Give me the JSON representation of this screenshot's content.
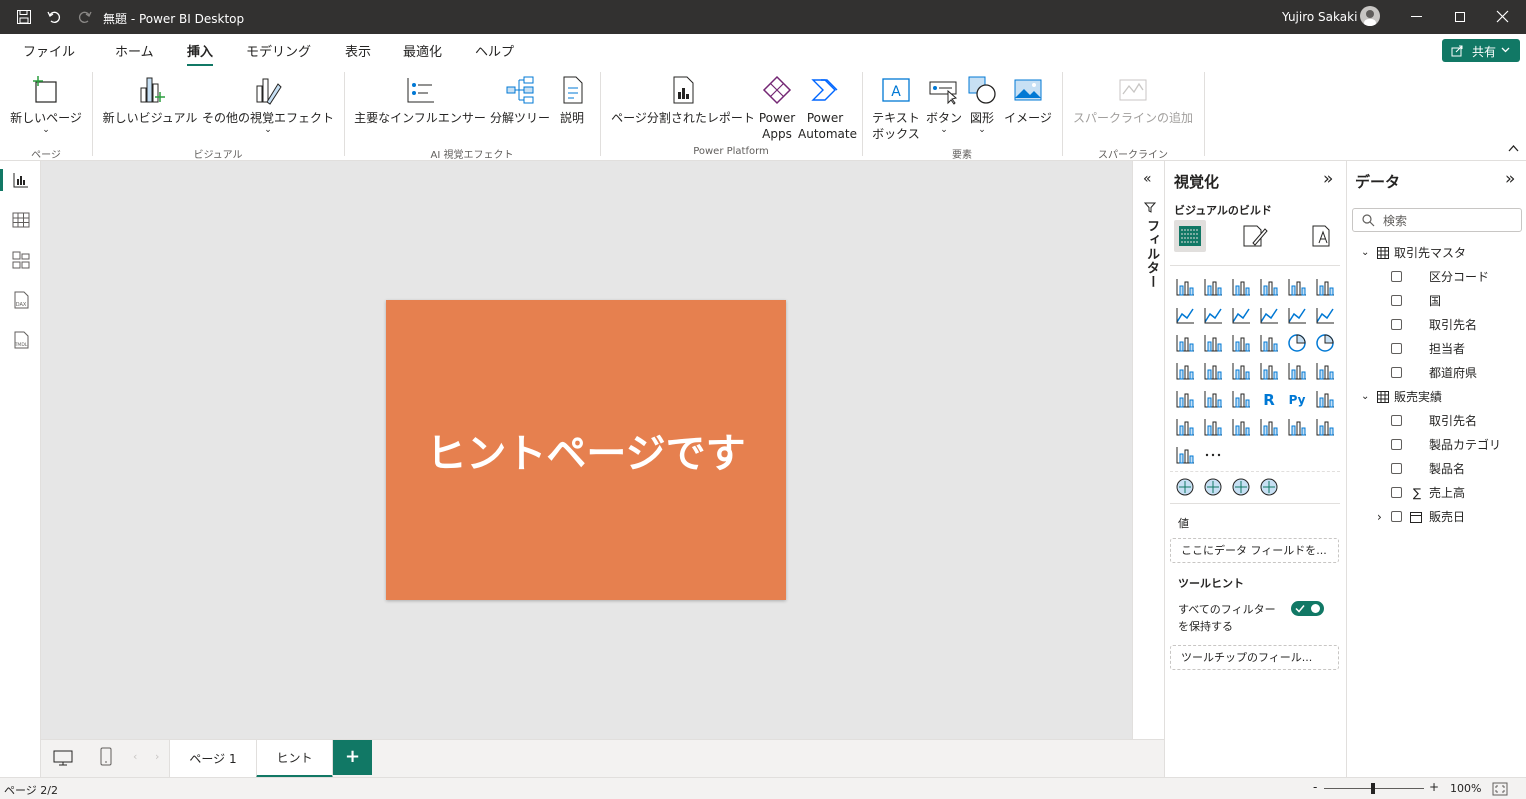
{
  "titlebar": {
    "title": "無題 - Power BI Desktop",
    "user": "Yujiro Sakaki"
  },
  "menu": {
    "tabs": [
      "ファイル",
      "ホーム",
      "挿入",
      "モデリング",
      "表示",
      "最適化",
      "ヘルプ"
    ],
    "active": "挿入",
    "share": "共有"
  },
  "ribbon": {
    "new_page": "新しいページ",
    "new_visual": "新しいビジュアル",
    "more_visuals": "その他の視覚エフェクト",
    "key_influencers": "主要なインフルエンサー",
    "decomp_tree": "分解ツリー",
    "narrative": "説明",
    "paginated": "ページ分割されたレポート",
    "power_apps_1": "Power",
    "power_apps_2": "Apps",
    "power_automate_1": "Power",
    "power_automate_2": "Automate",
    "textbox_1": "テキスト",
    "textbox_2": "ボックス",
    "buttons": "ボタン",
    "shapes": "図形",
    "image": "イメージ",
    "sparklines": "スパークラインの追加",
    "groups": {
      "page": "ページ",
      "visuals": "ビジュアル",
      "ai": "AI 視覚エフェクト",
      "platform": "Power Platform",
      "elements": "要素",
      "sparklines": "スパークライン"
    }
  },
  "canvas": {
    "card_text": "ヒントページです",
    "card_color": "#e6804f"
  },
  "pages": {
    "tabs": [
      "ページ 1",
      "ヒント"
    ],
    "active": "ヒント",
    "add": "+"
  },
  "filters": {
    "label": "フィルター"
  },
  "viz": {
    "title": "視覚化",
    "build": "ビジュアルのビルド",
    "values_label": "値",
    "values_placeholder": "ここにデータ フィールドを...",
    "tooltip_label": "ツールヒント",
    "keep_filters": "すべてのフィルター",
    "keep_filters_2": "を保持する",
    "tooltip_placeholder": "ツールチップのフィール..."
  },
  "data": {
    "title": "データ",
    "search_placeholder": "検索",
    "tables": [
      {
        "name": "取引先マスタ",
        "fields": [
          "区分コード",
          "国",
          "取引先名",
          "担当者",
          "都道府県"
        ]
      },
      {
        "name": "販売実績",
        "fields": [
          "取引先名",
          "製品カテゴリ",
          "製品名",
          "売上高"
        ],
        "sub": "販売日"
      }
    ]
  },
  "status": {
    "page": "ページ 2/2",
    "zoom": "100%"
  },
  "colors": {
    "accent": "#117865",
    "titlebar": "#323130"
  }
}
